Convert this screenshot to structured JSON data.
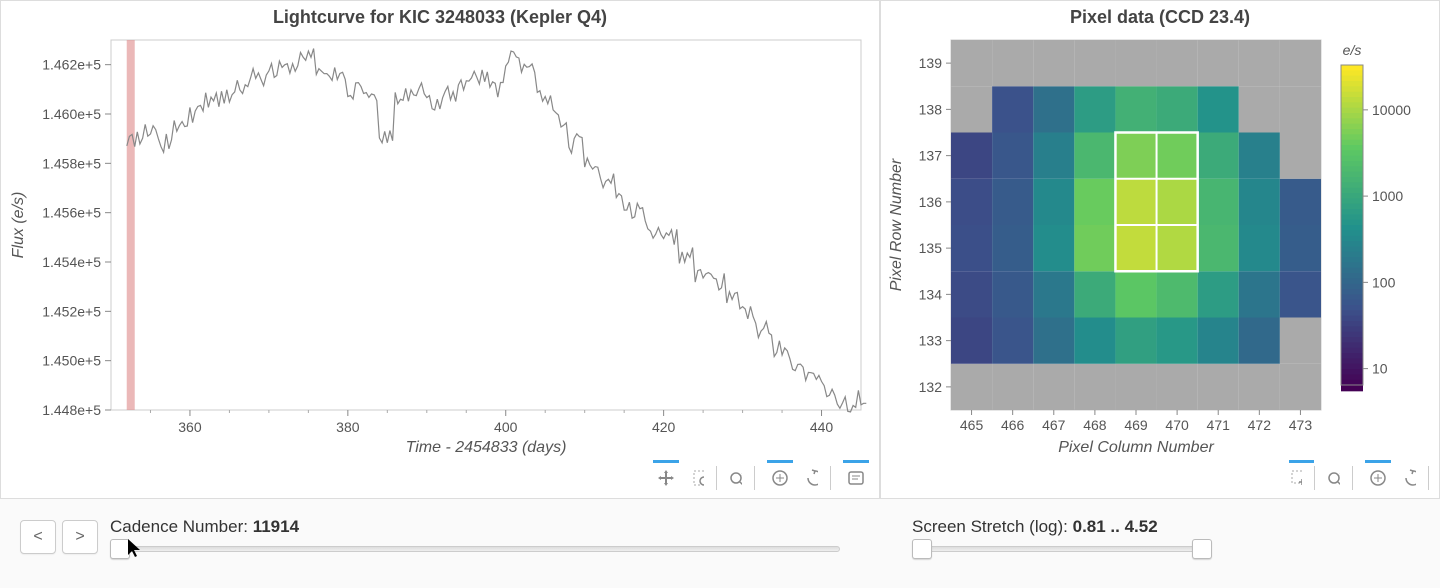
{
  "lightcurve": {
    "title": "Lightcurve for KIC 3248033 (Kepler Q4)",
    "xlabel": "Time - 2454833 (days)",
    "ylabel": "Flux (e/s)",
    "yticks": [
      "1.448e+5",
      "1.450e+5",
      "1.452e+5",
      "1.454e+5",
      "1.456e+5",
      "1.458e+5",
      "1.460e+5",
      "1.462e+5"
    ],
    "xticks": [
      "360",
      "380",
      "400",
      "420",
      "440"
    ],
    "cadence_marker_x": 352.5
  },
  "pixeldata": {
    "title": "Pixel data (CCD 23.4)",
    "xlabel": "Pixel Column Number",
    "ylabel": "Pixel Row Number",
    "xticks": [
      "465",
      "466",
      "467",
      "468",
      "469",
      "470",
      "471",
      "472",
      "473"
    ],
    "yticks": [
      "132",
      "133",
      "134",
      "135",
      "136",
      "137",
      "138",
      "139"
    ],
    "cbar_label": "e/s",
    "cbar_ticks": [
      "10",
      "100",
      "1000",
      "10000"
    ]
  },
  "controls": {
    "prev": "<",
    "next": ">",
    "cadence_label": "Cadence Number: ",
    "cadence_value": "11914",
    "stretch_label": "Screen Stretch (log): ",
    "stretch_value": "0.81 .. 4.52"
  },
  "chart_data": [
    {
      "type": "line",
      "title": "Lightcurve for KIC 3248033 (Kepler Q4)",
      "xlabel": "Time - 2454833 (days)",
      "ylabel": "Flux (e/s)",
      "xlim": [
        350,
        445
      ],
      "ylim": [
        144800,
        146300
      ],
      "cadence_marker_time": 352.5,
      "x": [
        352,
        354,
        356,
        358,
        360,
        362,
        364,
        366,
        368,
        370,
        372,
        374,
        376,
        378,
        380,
        382,
        384,
        386,
        388,
        390,
        392,
        394,
        396,
        398,
        400,
        402,
        404,
        406,
        408,
        410,
        412,
        414,
        416,
        418,
        420,
        422,
        424,
        426,
        428,
        430,
        432,
        434,
        436,
        438,
        440,
        442,
        444
      ],
      "y": [
        145900,
        145920,
        145880,
        145950,
        146000,
        146050,
        146080,
        146120,
        146150,
        146180,
        146200,
        146230,
        146180,
        146150,
        146100,
        146050,
        145900,
        146080,
        146100,
        146050,
        146080,
        146120,
        146150,
        146100,
        146230,
        146200,
        146080,
        145980,
        145880,
        145800,
        145720,
        145650,
        145600,
        145520,
        145500,
        145420,
        145350,
        145320,
        145250,
        145180,
        145120,
        145050,
        144980,
        144920,
        144880,
        144830,
        144850
      ]
    },
    {
      "type": "heatmap",
      "title": "Pixel data (CCD 23.4)",
      "xlabel": "Pixel Column Number",
      "ylabel": "Pixel Row Number",
      "colorbar_label": "e/s",
      "color_scale": "log",
      "color_range": [
        6.5,
        33000
      ],
      "x_range": [
        465,
        473
      ],
      "y_range": [
        132,
        139
      ],
      "aperture": {
        "cols": [
          469,
          470
        ],
        "rows": [
          135,
          136,
          137
        ]
      },
      "grid": [
        {
          "row": 132,
          "values": [
            null,
            null,
            null,
            null,
            null,
            null,
            null,
            null,
            null
          ]
        },
        {
          "row": 133,
          "values": [
            40,
            60,
            150,
            400,
            800,
            600,
            300,
            120,
            null
          ]
        },
        {
          "row": 134,
          "values": [
            45,
            70,
            200,
            1200,
            3500,
            2200,
            700,
            180,
            60
          ]
        },
        {
          "row": 135,
          "values": [
            50,
            80,
            400,
            5000,
            15000,
            12000,
            2000,
            350,
            80
          ]
        },
        {
          "row": 136,
          "values": [
            48,
            75,
            350,
            4500,
            14000,
            11000,
            1800,
            320,
            75
          ]
        },
        {
          "row": 137,
          "values": [
            40,
            65,
            250,
            2000,
            6000,
            5000,
            1200,
            260,
            null
          ]
        },
        {
          "row": 138,
          "values": [
            null,
            55,
            150,
            700,
            1500,
            1200,
            500,
            null,
            null
          ]
        },
        {
          "row": 139,
          "values": [
            null,
            null,
            null,
            null,
            null,
            null,
            null,
            null,
            null
          ]
        }
      ]
    }
  ]
}
